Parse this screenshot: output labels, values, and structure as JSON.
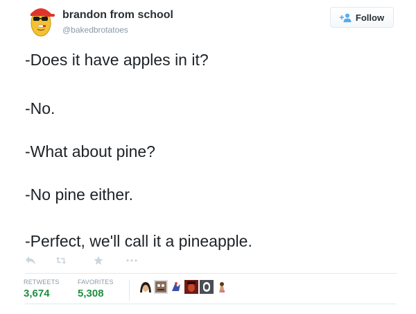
{
  "user": {
    "name": "brandon from school",
    "handle": "@bakedbrotatoes"
  },
  "follow_button": {
    "label": "Follow"
  },
  "tweet_lines": [
    "-Does it have apples in it?",
    "-No.",
    "-What about pine?",
    "-No pine either.",
    "-Perfect, we'll call it a pineapple."
  ],
  "actions": [
    {
      "name": "reply-icon"
    },
    {
      "name": "retweet-icon"
    },
    {
      "name": "favorite-icon"
    },
    {
      "name": "more-icon"
    }
  ],
  "stats": {
    "retweets_label": "RETWEETS",
    "retweets_value": "3,674",
    "favorites_label": "FAVORITES",
    "favorites_value": "5,308"
  },
  "favoriter_avatars": [
    "avatar-1",
    "avatar-2",
    "avatar-3",
    "avatar-4",
    "avatar-5",
    "avatar-6",
    "avatar-7"
  ],
  "colors": {
    "text": "#292f33",
    "muted": "#8899a6",
    "count_green": "#1e8e3e",
    "follow_icon": "#55acee",
    "border": "#e1e8ed"
  }
}
